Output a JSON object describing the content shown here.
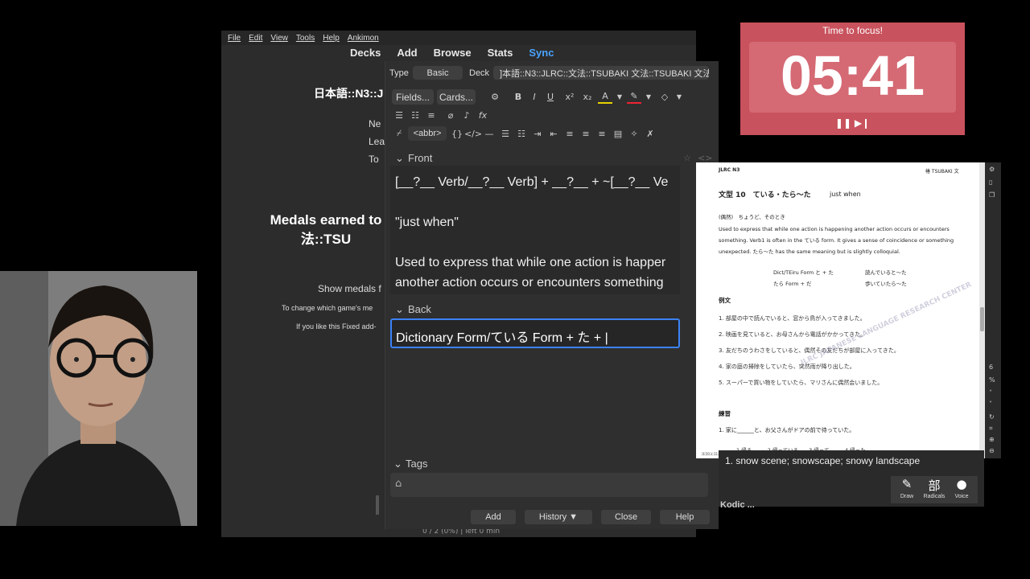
{
  "menu": [
    "File",
    "Edit",
    "View",
    "Tools",
    "Help",
    "Ankimon"
  ],
  "toolbar": {
    "decks": "Decks",
    "add": "Add",
    "browse": "Browse",
    "stats": "Stats",
    "sync": "Sync"
  },
  "deck_overview": {
    "title": "日本語::N3::J",
    "new_label": "Ne",
    "learn_label": "Lea",
    "review_label": "To",
    "medals_line1": "Medals earned to",
    "medals_line2": "法::TSU",
    "show_medals": "Show medals f",
    "change_game": "To change which game's me",
    "fixed_add": "If you like this Fixed add-",
    "status_text": "0 / 2 (0%) | left 0 min"
  },
  "add_dialog": {
    "type_label": "Type",
    "type_value": "Basic",
    "deck_label": "Deck",
    "deck_value": "]本語::N3::JLRC::文法::TSUBAKI 文法::TSUBAKI 文法",
    "fields_btn": "Fields...",
    "cards_btn": "Cards...",
    "abbr_btn": "<abbr>",
    "front_label": "Front",
    "front_line1": "[__?__ Verb/__?__ Verb] + __?__ + ~[__?__ Ve",
    "front_line2": "\"just when\"",
    "front_line3": "Used to express that while one action is happer",
    "front_line4": "another action occurs or encounters something",
    "back_label": "Back",
    "back_value": "Dictionary Form/ている Form + た + |",
    "tags_label": "Tags",
    "buttons": {
      "add": "Add",
      "history": "History ▼",
      "close": "Close",
      "help": "Help"
    }
  },
  "timer": {
    "title": "Time to focus!",
    "value": "05:41",
    "controls": "❚❚ ▶❙"
  },
  "pdf": {
    "header_left": "JLRC N3",
    "header_right": "椿 TSUBAKI 文",
    "section_title": "文型 10　ている・たら〜た",
    "section_meaning": "just when",
    "reading": "(偶然)　ちょうど、そのとき",
    "explanation1": "Used to express that while one action is happening another action occurs or encounters",
    "explanation2": "something. Verb1 is often in the ている form. It gives a sense of coincidence or something",
    "explanation3": "unexpected. たら〜た has the same meaning but is slightly colloquial.",
    "form1a": "Dict/TEiru Form と + た",
    "form1b": "読んでいると〜た",
    "form2a": "たら Form + だ",
    "form2b": "歩いていたら〜た",
    "examples_title": "例文",
    "examples": [
      "1. 部屋の中で読んでいると、窓から鳥が入ってきました。",
      "2. 映画を見ていると、お母さんから電話がかかってきた。",
      "3. 友だちのうわさをしていると、偶然その友だちが部屋に入ってきた。",
      "4. 家の庭の掃除をしていたら、突然雨が降り出した。",
      "5. スーパーで買い物をしていたら、マリさんに偶然会いました。"
    ],
    "practice_title": "練習",
    "practice1": "1. 家に______と、お父さんがドアの前で待っていた。",
    "choices": "1 帰る　　　2 帰っている　　3 帰って　　　4 帰った",
    "watermark": "JLRC JAPANESE LANGUAGE RESEARCH CENTER",
    "page_size": "8.50 x 11.00 in"
  },
  "dictionary": {
    "entry": "1.  snow scene; snowscape; snowy landscape",
    "entry_title": "Kodic ...",
    "draw": "Draw",
    "radicals_glyph": "部",
    "radicals": "Radicals",
    "voice": "Voice"
  }
}
